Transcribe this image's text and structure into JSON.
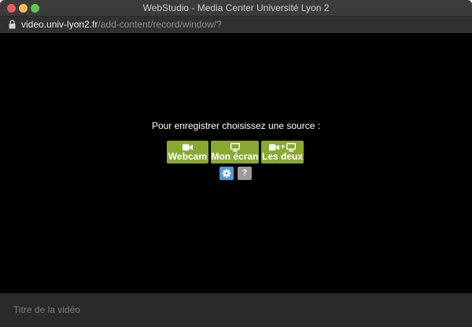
{
  "window": {
    "title": "WebStudio - Media Center Université Lyon 2"
  },
  "address_bar": {
    "domain": "video.univ-lyon2.fr",
    "path": "/add-content/record/window/?"
  },
  "recorder": {
    "prompt": "Pour enregistrer choisissez une source :",
    "sources": [
      {
        "label": "Webcam",
        "icon": "video-camera-icon"
      },
      {
        "label": "Mon écran",
        "icon": "monitor-icon"
      },
      {
        "label": "Les deux",
        "icon": "video-camera-plus-monitor-icon",
        "joiner": "+"
      }
    ],
    "help_label": "?",
    "accent_color": "#8aa933",
    "settings_color": "#4b9dd6"
  },
  "footer": {
    "title_placeholder": "Titre de la vidéo"
  }
}
